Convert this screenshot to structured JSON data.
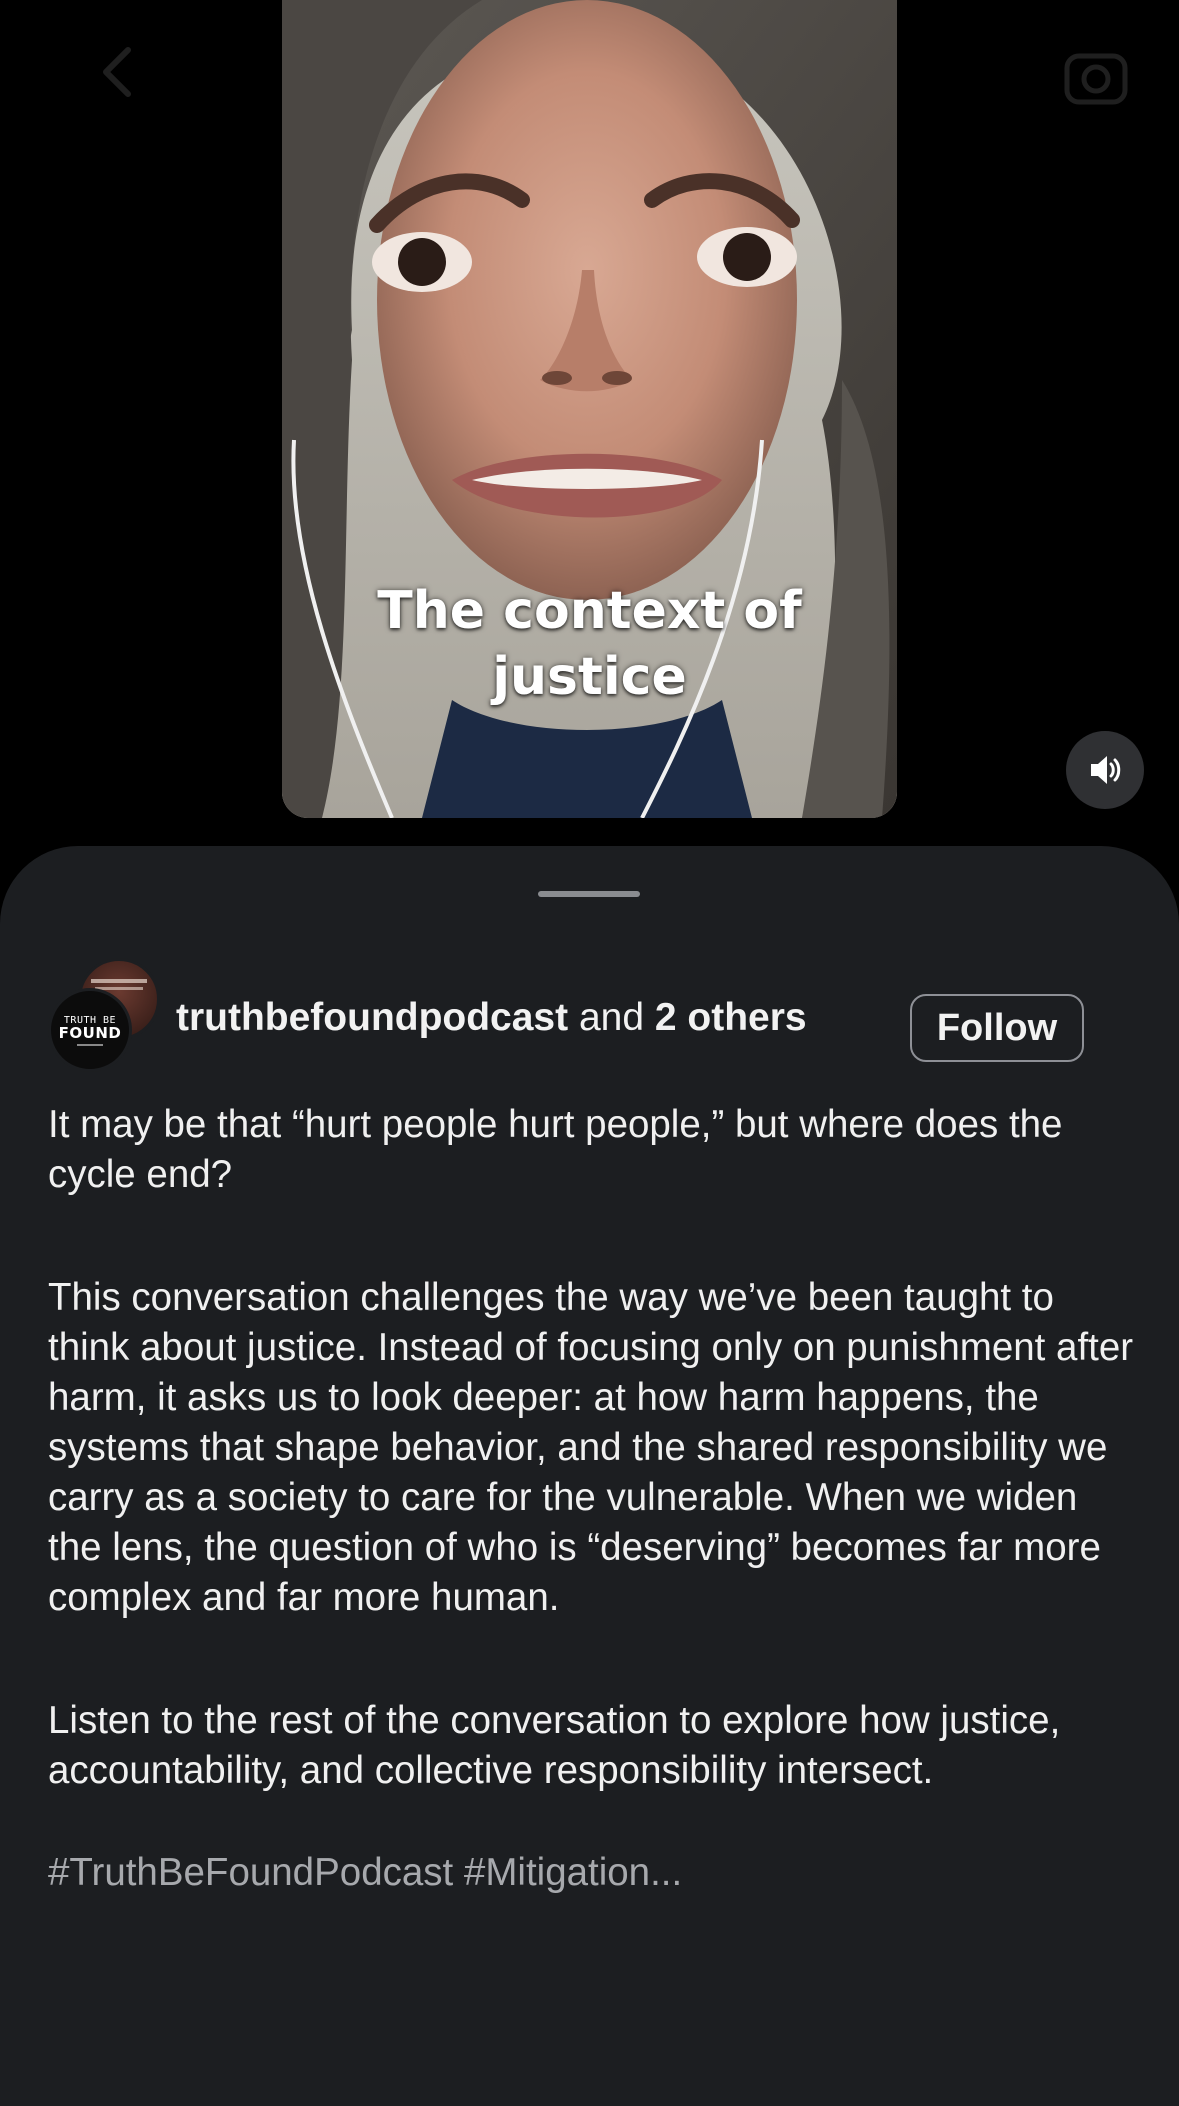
{
  "video": {
    "caption_line1": "The context of",
    "caption_line2": "justice"
  },
  "icons": {
    "back": "chevron-left-icon",
    "camera": "camera-icon",
    "mute": "speaker-volume-icon"
  },
  "post": {
    "author_name": "truthbefoundpodcast",
    "author_joiner": "and",
    "others": "2 others",
    "follow_label": "Follow",
    "avatar_text_top": "TRUTH BE",
    "avatar_text_bottom": "FOUND",
    "paragraph1": "It may be that “hurt people hurt people,” but where does the cycle end?",
    "paragraph2": "This conversation challenges the way we’ve been taught to think about justice. Instead of focusing only on punishment after harm, it asks us to look deeper: at how harm happens, the systems that shape behavior, and the shared responsibility we carry as a society to care for the vulnerable. When we widen the lens, the question of who is “deserving” becomes far more complex and far more human.",
    "paragraph3": "Listen to the rest of the conversation to explore how justice, accountability, and collective responsibility intersect.",
    "hashtags": "#TruthBeFoundPodcast #Mitigation..."
  },
  "colors": {
    "sheet_bg": "#1c1e21",
    "page_bg": "#000000",
    "text": "#f2f2f2",
    "hashtag": "#a7a9ad"
  }
}
